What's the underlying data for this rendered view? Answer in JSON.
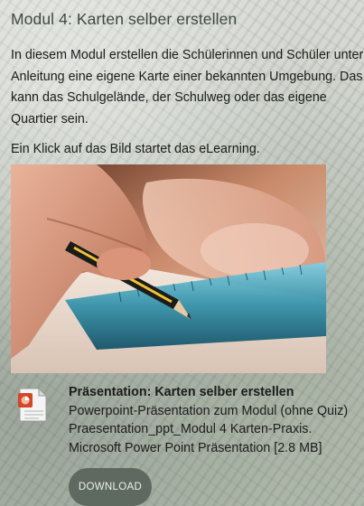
{
  "module": {
    "title": "Modul 4: Karten selber erstellen",
    "intro": "In diesem Modul erstellen die Schülerinnen und Schüler unter\nAnleitung eine eigene Karte einer bekannten Umgebung. Das\nkann das Schulgelände, der Schulweg oder das eigene\nQuartier sein.",
    "click_hint": "Ein Klick auf das Bild startet das eLearning."
  },
  "download": {
    "title": "Präsentation: Karten selber erstellen",
    "description": "Powerpoint-Präsentation zum Modul (ohne Quiz)",
    "filename": "Praesentation_ppt_Modul 4 Karten-Praxis.",
    "filetype": "Microsoft Power Point Präsentation [2.8 MB]",
    "button_label": "DOWNLOAD",
    "icon": "powerpoint-file-icon"
  },
  "colors": {
    "title": "#3f4a40",
    "button_bg": "#5e6a5f",
    "button_text": "#eef0ec",
    "ruler": "#2f8fa8"
  }
}
